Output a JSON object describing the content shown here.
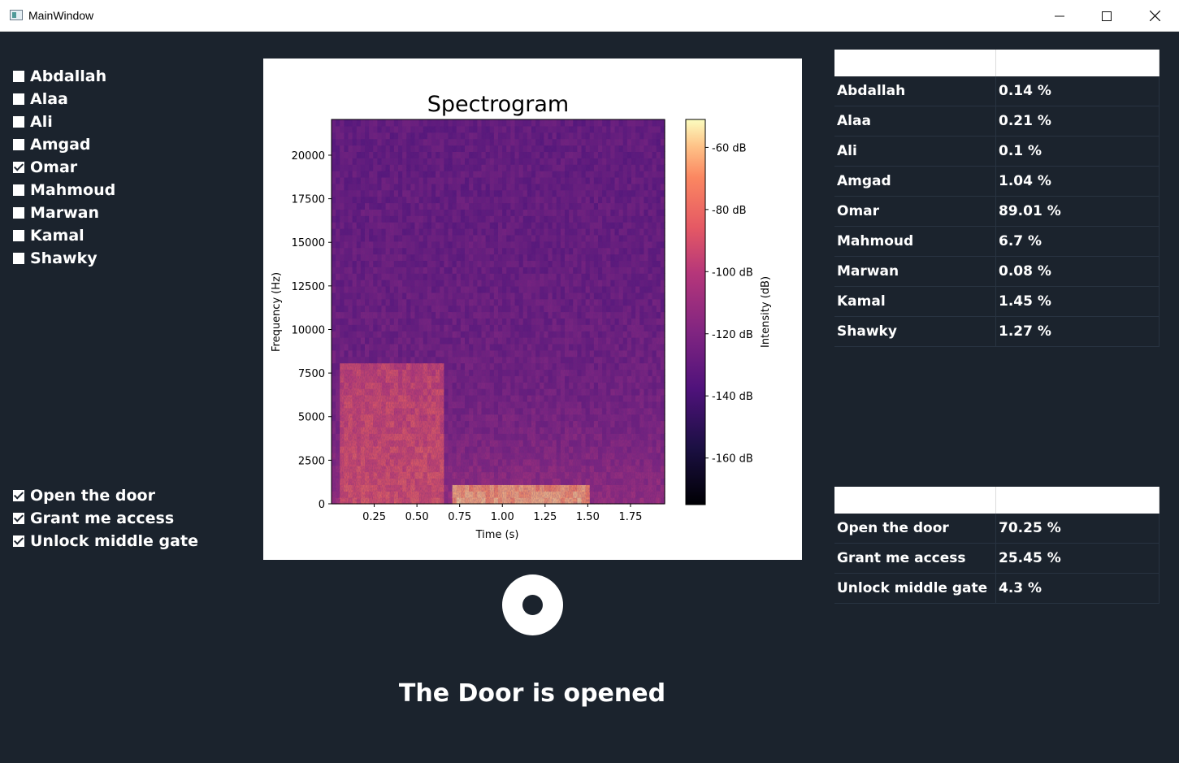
{
  "window": {
    "title": "MainWindow"
  },
  "speakers": [
    {
      "label": "Abdallah",
      "checked": false
    },
    {
      "label": "Alaa",
      "checked": false
    },
    {
      "label": "Ali",
      "checked": false
    },
    {
      "label": "Amgad",
      "checked": false
    },
    {
      "label": "Omar",
      "checked": true
    },
    {
      "label": "Mahmoud",
      "checked": false
    },
    {
      "label": "Marwan",
      "checked": false
    },
    {
      "label": "Kamal",
      "checked": false
    },
    {
      "label": "Shawky",
      "checked": false
    }
  ],
  "sentences": [
    {
      "label": "Open the door",
      "checked": true
    },
    {
      "label": "Grant me access",
      "checked": true
    },
    {
      "label": "Unlock middle gate",
      "checked": true
    }
  ],
  "speaker_table": {
    "headers": [
      "",
      ""
    ],
    "rows": [
      [
        "Abdallah",
        "0.14 %"
      ],
      [
        "Alaa",
        "0.21 %"
      ],
      [
        "Ali",
        "0.1 %"
      ],
      [
        "Amgad",
        "1.04 %"
      ],
      [
        "Omar",
        "89.01 %"
      ],
      [
        "Mahmoud",
        "6.7 %"
      ],
      [
        "Marwan",
        "0.08 %"
      ],
      [
        "Kamal",
        "1.45 %"
      ],
      [
        "Shawky",
        "1.27 %"
      ]
    ]
  },
  "sentence_table": {
    "headers": [
      "",
      ""
    ],
    "rows": [
      [
        "Open the door",
        "70.25 %"
      ],
      [
        "Grant me access",
        "25.45 %"
      ],
      [
        "Unlock middle gate",
        "4.3 %"
      ]
    ]
  },
  "status_text": "The Door is opened",
  "chart_data": {
    "type": "heatmap",
    "title": "Spectrogram",
    "xlabel": "Time (s)",
    "ylabel": "Frequency (Hz)",
    "xlim": [
      0,
      1.95
    ],
    "ylim": [
      0,
      22050
    ],
    "x_ticks": [
      0.25,
      0.5,
      0.75,
      1.0,
      1.25,
      1.5,
      1.75
    ],
    "x_tick_labels": [
      "0.25",
      "0.50",
      "0.75",
      "1.00",
      "1.25",
      "1.50",
      "1.75"
    ],
    "y_ticks": [
      0,
      2500,
      5000,
      7500,
      10000,
      12500,
      15000,
      17500,
      20000
    ],
    "y_tick_labels": [
      "0",
      "2500",
      "5000",
      "7500",
      "10000",
      "12500",
      "15000",
      "17500",
      "20000"
    ],
    "colorbar": {
      "label": "Intensity (dB)",
      "range": [
        -175,
        -51
      ],
      "ticks": [
        -60,
        -80,
        -100,
        -120,
        -140,
        -160
      ],
      "tick_labels": [
        "-60 dB",
        "-80 dB",
        "-100 dB",
        "-120 dB",
        "-140 dB",
        "-160 dB"
      ],
      "colormap": "magma"
    },
    "energy_regions": [
      {
        "t": [
          0.05,
          0.65
        ],
        "f": [
          0,
          8000
        ],
        "level_db": -85
      },
      {
        "t": [
          0.7,
          1.5
        ],
        "f": [
          0,
          1000
        ],
        "level_db": -60
      },
      {
        "t": [
          0.0,
          1.95
        ],
        "f": [
          12000,
          22050
        ],
        "level_db": -140
      }
    ]
  }
}
